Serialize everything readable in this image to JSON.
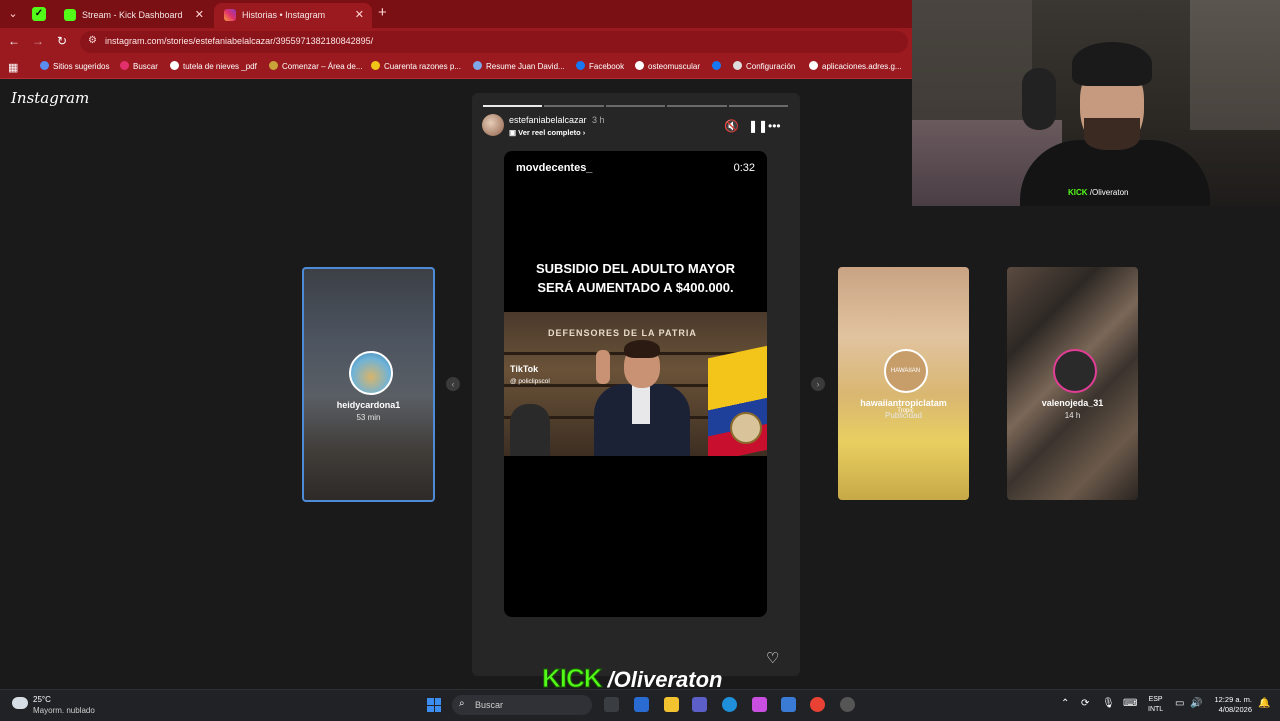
{
  "browser": {
    "tabs": [
      {
        "title": "Stream - Kick Dashboard",
        "favicon": "kick-icon",
        "color": "#53fc18"
      },
      {
        "title": "Historias • Instagram",
        "favicon": "instagram-icon",
        "color": "#e1306c"
      }
    ],
    "url": "instagram.com/stories/estefaniabelalcazar/3955971382180842895/",
    "bookmarks": [
      {
        "label": "Sitios sugeridos",
        "icon": "app-icon"
      },
      {
        "label": "Buscar",
        "icon": "instagram-icon"
      },
      {
        "label": "tutela de nieves _pdf",
        "icon": "globe-icon"
      },
      {
        "label": "Comenzar – Área de...",
        "icon": "link-icon"
      },
      {
        "label": "Cuarenta razones p...",
        "icon": "pin-icon"
      },
      {
        "label": "Resume Juan David...",
        "icon": "resume-icon"
      },
      {
        "label": "Facebook",
        "icon": "facebook-icon"
      },
      {
        "label": "osteomuscular",
        "icon": "globe-icon"
      },
      {
        "label": "Configuración",
        "icon": "gear-icon"
      },
      {
        "label": "aplicaciones.adres.g...",
        "icon": "globe-icon"
      }
    ]
  },
  "instagram": {
    "logo": "Instagram",
    "story": {
      "username": "estefaniabelalcazar",
      "time": "3 h",
      "reel_link": "Ver reel completo",
      "segments_total": 5,
      "segments_done": 1,
      "video": {
        "username": "movdecentes_",
        "duration": "0:32",
        "headline_line1": "SUBSIDIO DEL ADULTO MAYOR",
        "headline_line2": "SERÁ AUMENTADO A $400.000.",
        "banner": "DEFENSORES DE LA PATRIA",
        "tiktok_logo": "TikTok",
        "tiktok_handle": "@ policlipscol"
      }
    },
    "previews": [
      {
        "username": "heidycardona1",
        "meta": "53 min"
      },
      {
        "username": "hawaiiantropiclatam",
        "meta": "Publicidad",
        "avatar_text": "HAWAIIAN Tropic"
      },
      {
        "username": "valenojeda_31",
        "meta": "14 h"
      }
    ]
  },
  "webcam": {
    "kick_label": "KICK",
    "handle": "/Oliveraton"
  },
  "overlay": {
    "kick_label": "KICK",
    "handle": "/Oliveraton"
  },
  "taskbar": {
    "temperature": "25°C",
    "weather": "Mayorm. nublado",
    "search_placeholder": "Buscar",
    "lang_line1": "ESP",
    "lang_line2": "INTL",
    "time": "12:29 a. m.",
    "date": "4/08/2026"
  }
}
